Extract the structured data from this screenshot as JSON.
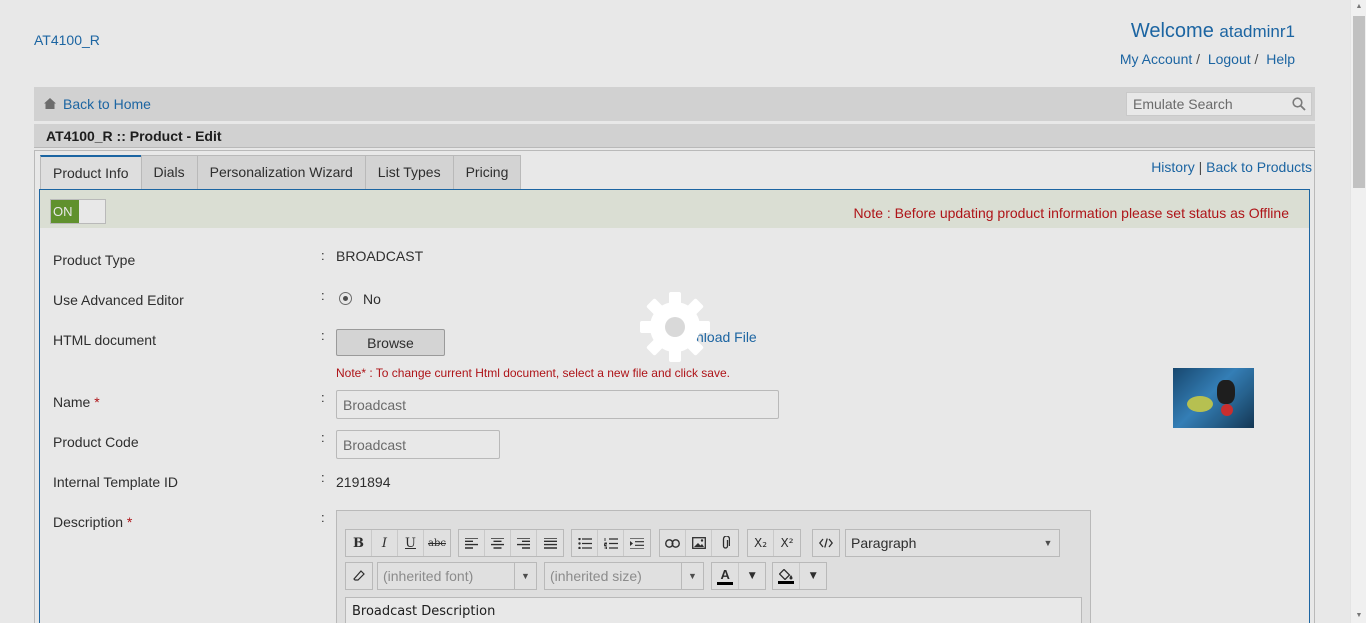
{
  "header": {
    "brand": "AT4100_R",
    "welcome_text": "Welcome",
    "username": "atadminr1",
    "links": [
      "My Account",
      "Logout",
      "Help"
    ]
  },
  "navbar": {
    "back_home": "Back to Home",
    "emulate_placeholder": "Emulate Search"
  },
  "page_title": "AT4100_R :: Product - Edit",
  "tabs": [
    "Product Info",
    "Dials",
    "Personalization Wizard",
    "List Types",
    "Pricing"
  ],
  "panel_links": {
    "history": "History",
    "back_to_products": "Back to Products"
  },
  "status": {
    "toggle": "ON",
    "note": "Note : Before updating product information please set status as Offline"
  },
  "form": {
    "product_type_label": "Product Type",
    "product_type_value": "BROADCAST",
    "advanced_editor_label": "Use Advanced Editor",
    "advanced_editor_value": "No",
    "html_document_label": "HTML document",
    "browse_label": "Browse",
    "file_link": "Download File",
    "html_note": "Note* : To change current Html document, select a new file and click save.",
    "name_label": "Name",
    "name_placeholder": "Broadcast",
    "product_code_label": "Product Code",
    "product_code_placeholder": "Broadcast",
    "template_id_label": "Internal Template ID",
    "template_id_value": "2191894",
    "description_label": "Description",
    "required_mark": "*",
    "colon": ":"
  },
  "editor": {
    "format_select": "Paragraph",
    "font_select": "(inherited font)",
    "size_select": "(inherited size)",
    "content": "Broadcast Description",
    "buttons": {
      "bold": "B",
      "italic": "I",
      "underline": "U",
      "strike": "abc",
      "subscript": "X₂",
      "superscript": "X²",
      "font_color": "A"
    }
  }
}
